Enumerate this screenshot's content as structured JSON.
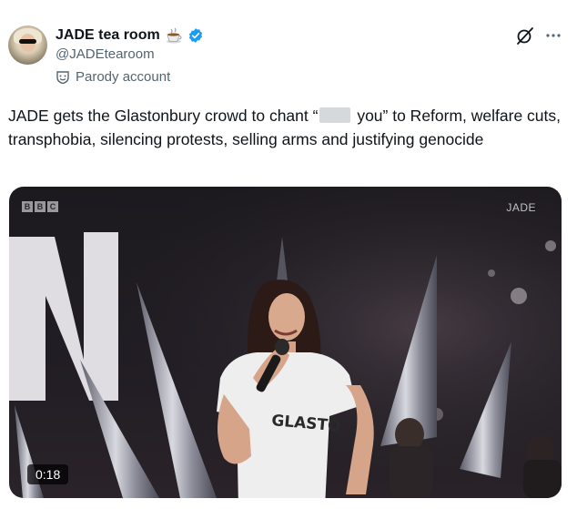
{
  "author": {
    "display_name": "JADE tea room",
    "handle": "@JADEtearoom",
    "parody_label": "Parody account"
  },
  "tweet": {
    "text_before": "JADE gets the Glastonbury crowd to chant “",
    "text_after": " you” to Reform, welfare cuts, transphobia, silencing protests, selling arms and justifying genocide"
  },
  "media": {
    "broadcaster_letters": [
      "B",
      "B",
      "C"
    ],
    "watermark": "JADE",
    "duration": "0:18",
    "shirt_text": "GLASTO"
  },
  "icons": {
    "name_emoji": "hot-beverage-icon",
    "verified": "verified-badge-icon",
    "parody": "parody-mask-icon",
    "grok": "grok-icon",
    "more": "more-options-icon"
  },
  "colors": {
    "text_primary": "#0f1419",
    "text_secondary": "#536471",
    "verified_blue": "#1d9bf0"
  }
}
